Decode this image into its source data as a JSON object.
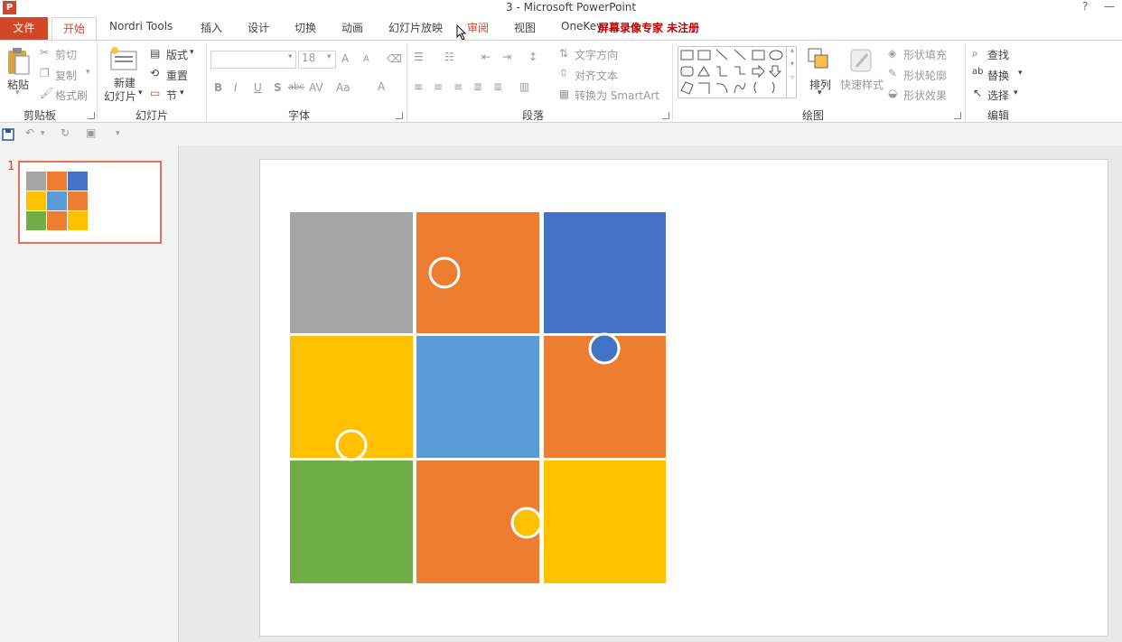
{
  "window": {
    "title": "3 - Microsoft PowerPoint",
    "help": "?",
    "minimize": "—",
    "overlay_text": "屏幕录像专家  未注册"
  },
  "tabs": [
    {
      "label": "文件"
    },
    {
      "label": "开始"
    },
    {
      "label": "Nordri Tools"
    },
    {
      "label": "插入"
    },
    {
      "label": "设计"
    },
    {
      "label": "切换"
    },
    {
      "label": "动画"
    },
    {
      "label": "幻灯片放映"
    },
    {
      "label": "审阅"
    },
    {
      "label": "视图"
    },
    {
      "label": "OneKey"
    }
  ],
  "ribbon": {
    "clipboard": {
      "paste": "粘贴",
      "cut": "剪切",
      "copy": "复制",
      "format_painter": "格式刷",
      "label": "剪贴板"
    },
    "slides": {
      "new_slide_line1": "新建",
      "new_slide_line2": "幻灯片",
      "layout": "版式",
      "reset": "重置",
      "section": "节",
      "label": "幻灯片"
    },
    "font": {
      "font_name": "",
      "font_size": "18",
      "grow": "A",
      "shrink": "A",
      "bold": "B",
      "italic": "I",
      "underline": "U",
      "shadow": "S",
      "strike": "abc",
      "spacing": "AV",
      "case": "Aa",
      "color": "A",
      "label": "字体"
    },
    "paragraph": {
      "text_direction": "文字方向",
      "align_text": "对齐文本",
      "smartart": "转换为 SmartArt",
      "label": "段落"
    },
    "drawing": {
      "arrange": "排列",
      "quick_styles": "快速样式",
      "shape_fill": "形状填充",
      "shape_outline": "形状轮廓",
      "shape_effects": "形状效果",
      "label": "绘图"
    },
    "editing": {
      "find": "查找",
      "replace": "替换",
      "select": "选择",
      "label": "编辑"
    }
  },
  "thumbnail": {
    "slide_number": "1"
  },
  "colors": {
    "accent": "#d24726",
    "gray": "#a5a5a5",
    "orange": "#ed7d31",
    "blue": "#4472c4",
    "yellow": "#ffc000",
    "light_blue": "#5b9bd5",
    "green": "#70ad47"
  },
  "puzzle": {
    "pieces": [
      {
        "name": "piece-top-left",
        "color": "gray"
      },
      {
        "name": "piece-top-middle",
        "color": "orange"
      },
      {
        "name": "piece-top-right",
        "color": "blue"
      },
      {
        "name": "piece-middle-left",
        "color": "yellow"
      },
      {
        "name": "piece-center",
        "color": "light_blue"
      },
      {
        "name": "piece-middle-right",
        "color": "orange"
      },
      {
        "name": "piece-bottom-left",
        "color": "green"
      },
      {
        "name": "piece-bottom-middle",
        "color": "orange"
      },
      {
        "name": "piece-bottom-right",
        "color": "yellow"
      }
    ]
  }
}
